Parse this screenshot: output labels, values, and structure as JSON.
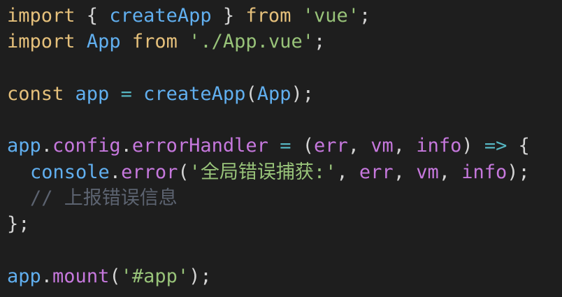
{
  "lines": [
    {
      "tokens": [
        {
          "text": "import",
          "kind": "kw-yellow"
        },
        {
          "text": " { ",
          "kind": "punct"
        },
        {
          "text": "createApp",
          "kind": "ident-blue"
        },
        {
          "text": " } ",
          "kind": "punct"
        },
        {
          "text": "from",
          "kind": "kw-yellow"
        },
        {
          "text": " ",
          "kind": "punct"
        },
        {
          "text": "'vue'",
          "kind": "str"
        },
        {
          "text": ";",
          "kind": "punct"
        }
      ]
    },
    {
      "tokens": [
        {
          "text": "import",
          "kind": "kw-yellow"
        },
        {
          "text": " ",
          "kind": "punct"
        },
        {
          "text": "App",
          "kind": "ident-blue"
        },
        {
          "text": " ",
          "kind": "punct"
        },
        {
          "text": "from",
          "kind": "kw-yellow"
        },
        {
          "text": " ",
          "kind": "punct"
        },
        {
          "text": "'./App.vue'",
          "kind": "str"
        },
        {
          "text": ";",
          "kind": "punct"
        }
      ]
    },
    {
      "tokens": []
    },
    {
      "tokens": [
        {
          "text": "const",
          "kind": "kw-yellow"
        },
        {
          "text": " ",
          "kind": "punct"
        },
        {
          "text": "app",
          "kind": "ident-blue"
        },
        {
          "text": " ",
          "kind": "punct"
        },
        {
          "text": "=",
          "kind": "op"
        },
        {
          "text": " ",
          "kind": "punct"
        },
        {
          "text": "createApp",
          "kind": "ident-blue"
        },
        {
          "text": "(",
          "kind": "punct"
        },
        {
          "text": "App",
          "kind": "ident-blue"
        },
        {
          "text": ");",
          "kind": "punct"
        }
      ]
    },
    {
      "tokens": []
    },
    {
      "tokens": [
        {
          "text": "app",
          "kind": "ident-blue"
        },
        {
          "text": ".",
          "kind": "punct"
        },
        {
          "text": "config",
          "kind": "ident-purple"
        },
        {
          "text": ".",
          "kind": "punct"
        },
        {
          "text": "errorHandler",
          "kind": "ident-purple"
        },
        {
          "text": " ",
          "kind": "punct"
        },
        {
          "text": "=",
          "kind": "op"
        },
        {
          "text": " (",
          "kind": "punct"
        },
        {
          "text": "err",
          "kind": "ident-purple"
        },
        {
          "text": ", ",
          "kind": "punct"
        },
        {
          "text": "vm",
          "kind": "ident-purple"
        },
        {
          "text": ", ",
          "kind": "punct"
        },
        {
          "text": "info",
          "kind": "ident-purple"
        },
        {
          "text": ") ",
          "kind": "punct"
        },
        {
          "text": "=>",
          "kind": "op"
        },
        {
          "text": " {",
          "kind": "punct"
        }
      ]
    },
    {
      "indent": true,
      "tokens": [
        {
          "text": "console",
          "kind": "ident-blue"
        },
        {
          "text": ".",
          "kind": "punct"
        },
        {
          "text": "error",
          "kind": "ident-purple"
        },
        {
          "text": "(",
          "kind": "punct"
        },
        {
          "text": "'全局错误捕获:'",
          "kind": "str"
        },
        {
          "text": ", ",
          "kind": "punct"
        },
        {
          "text": "err",
          "kind": "ident-purple"
        },
        {
          "text": ", ",
          "kind": "punct"
        },
        {
          "text": "vm",
          "kind": "ident-purple"
        },
        {
          "text": ", ",
          "kind": "punct"
        },
        {
          "text": "info",
          "kind": "ident-purple"
        },
        {
          "text": ");",
          "kind": "punct"
        }
      ]
    },
    {
      "indent": true,
      "tokens": [
        {
          "text": "// 上报错误信息",
          "kind": "comment"
        }
      ]
    },
    {
      "tokens": [
        {
          "text": "};",
          "kind": "punct"
        }
      ]
    },
    {
      "tokens": []
    },
    {
      "tokens": [
        {
          "text": "app",
          "kind": "ident-blue"
        },
        {
          "text": ".",
          "kind": "punct"
        },
        {
          "text": "mount",
          "kind": "ident-purple"
        },
        {
          "text": "(",
          "kind": "punct"
        },
        {
          "text": "'#app'",
          "kind": "str"
        },
        {
          "text": ");",
          "kind": "punct"
        }
      ]
    }
  ]
}
